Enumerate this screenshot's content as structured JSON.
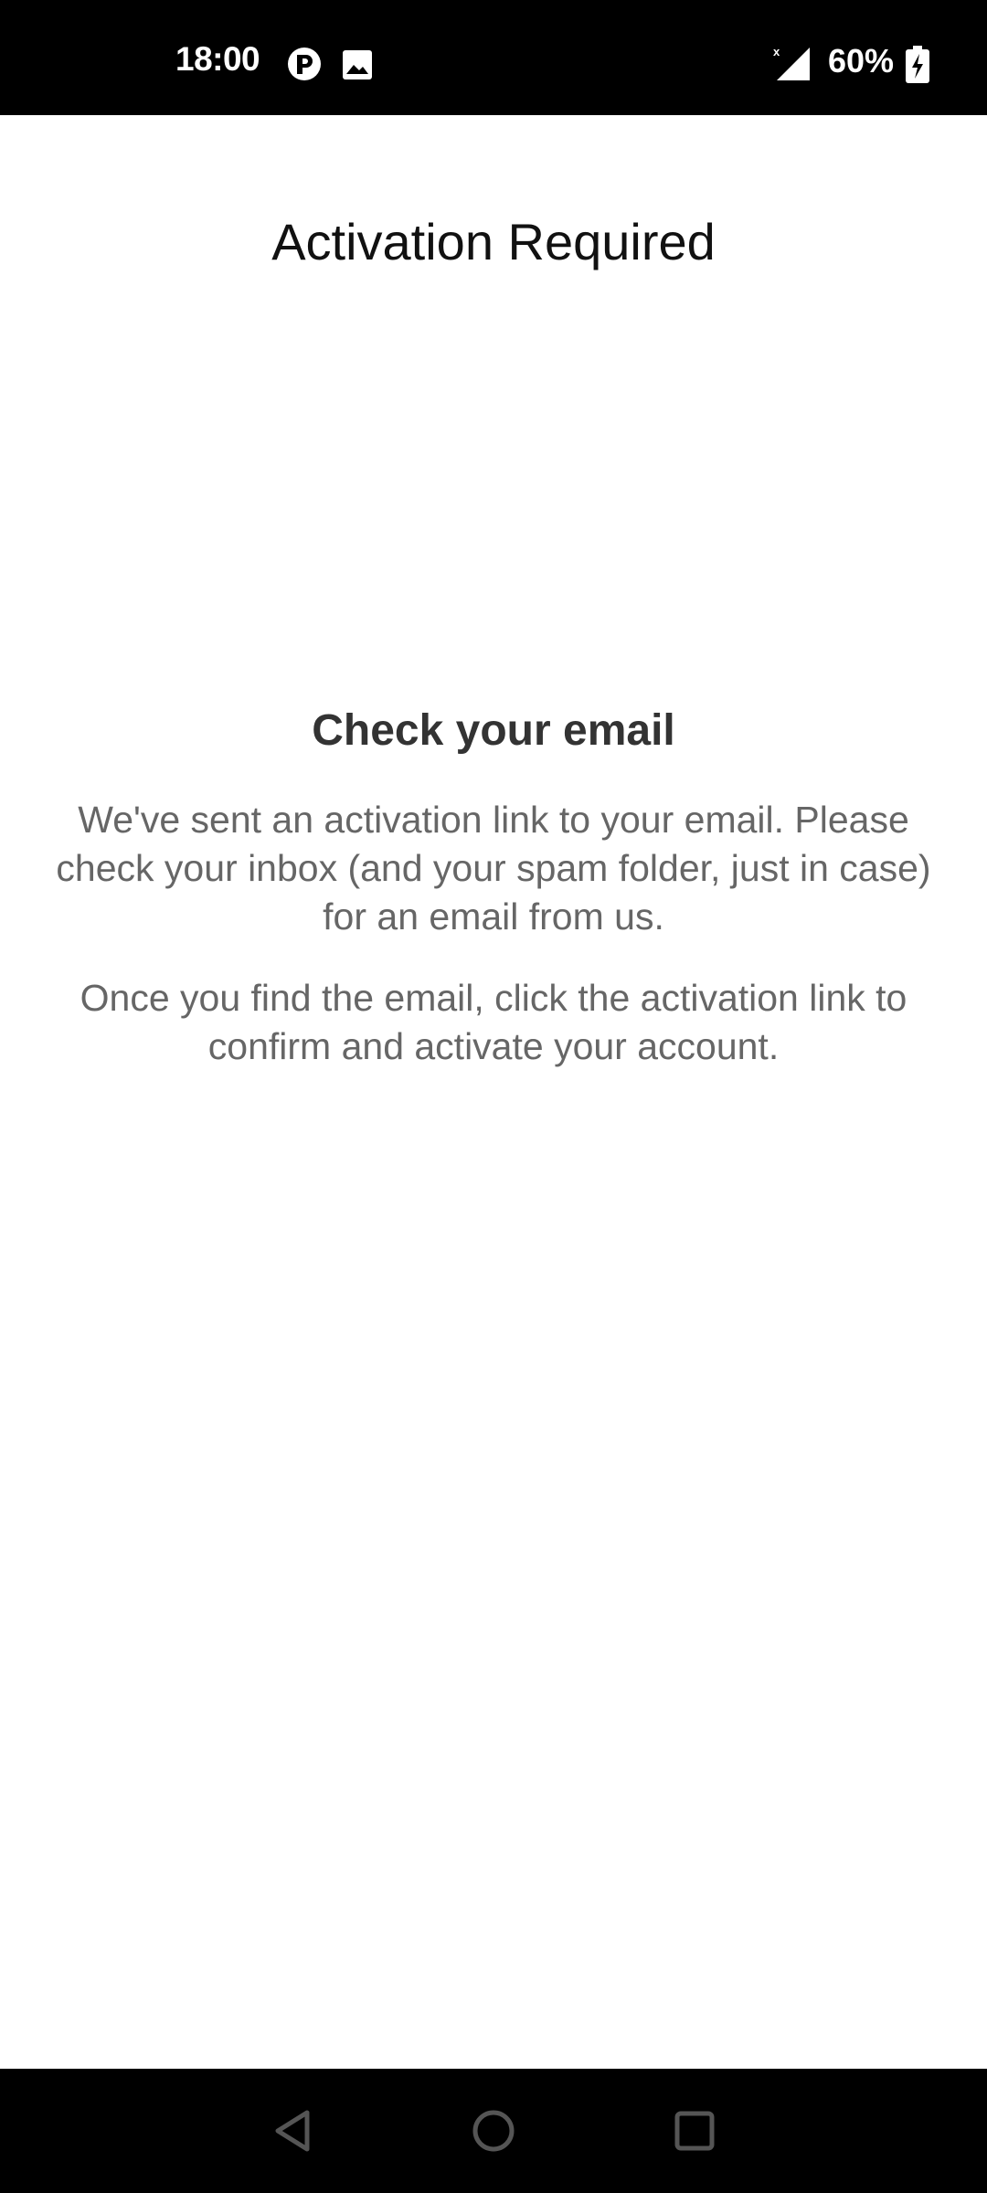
{
  "status_bar": {
    "time": "18:00",
    "battery": "60%",
    "icons": [
      "p-app-icon",
      "image-icon",
      "signal-icon",
      "battery-charging-icon"
    ]
  },
  "page": {
    "title": "Activation Required"
  },
  "message": {
    "heading": "Check your email",
    "paragraph1": "We've sent an activation link to your email. Please check your inbox (and your spam folder, just in case) for an email from us.",
    "paragraph2": "Once you find the email, click the activation link to confirm and activate your account."
  },
  "nav_bar": {
    "buttons": [
      "back-icon",
      "home-icon",
      "recents-icon"
    ]
  }
}
